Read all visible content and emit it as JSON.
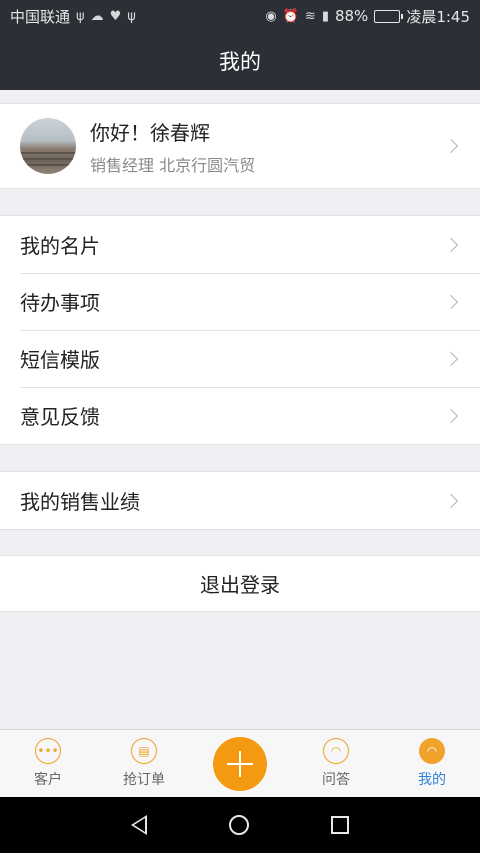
{
  "status_bar": {
    "carrier": "中国联通",
    "battery_percent": "88%",
    "time": "凌晨1:45",
    "battery_level": 0.88,
    "icons": [
      "usb-icon",
      "cloud-icon",
      "heart-icon",
      "usb-icon",
      "location-icon",
      "alarm-icon",
      "wifi-icon",
      "signal-icon",
      "battery-icon"
    ]
  },
  "header": {
    "title": "我的"
  },
  "profile": {
    "greeting": "你好！徐春辉",
    "subtitle": "销售经理 北京行圆汽贸"
  },
  "menu_group_1": {
    "items": [
      {
        "label": "我的名片"
      },
      {
        "label": "待办事项"
      },
      {
        "label": "短信模版"
      },
      {
        "label": "意见反馈"
      }
    ]
  },
  "menu_group_2": {
    "items": [
      {
        "label": "我的销售业绩"
      }
    ]
  },
  "logout": {
    "label": "退出登录"
  },
  "tab_bar": {
    "tabs": [
      {
        "label": "客户",
        "icon": "ellipsis-icon"
      },
      {
        "label": "抢订单",
        "icon": "document-icon"
      },
      {
        "label": "",
        "icon": "plus-icon"
      },
      {
        "label": "问答",
        "icon": "user-icon"
      },
      {
        "label": "我的",
        "icon": "user-icon",
        "active": true
      }
    ],
    "accent_color": "#f39a12",
    "active_color": "#2f86d6"
  }
}
